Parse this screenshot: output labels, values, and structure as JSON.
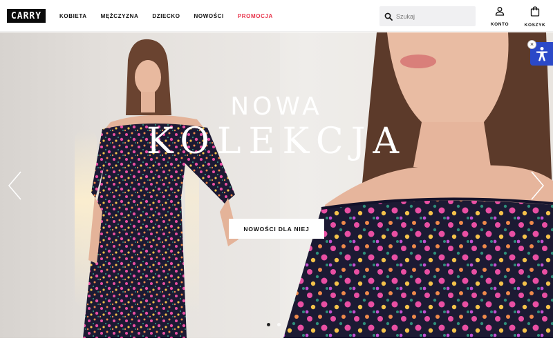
{
  "brand": {
    "logo_text": "CARRY"
  },
  "nav": {
    "items": [
      {
        "label": "KOBIETA"
      },
      {
        "label": "MĘŻCZYZNA"
      },
      {
        "label": "DZIECKO"
      },
      {
        "label": "NOWOŚCI"
      },
      {
        "label": "PROMOCJA"
      }
    ]
  },
  "search": {
    "placeholder": "Szukaj",
    "value": ""
  },
  "header_icons": {
    "account_label": "KONTO",
    "cart_label": "KOSZYK"
  },
  "hero": {
    "headline_line1": "NOWA",
    "headline_line2": "KOLEKCJA",
    "cta_label": "NOWOŚCI DLA NIEJ",
    "slide_count": 2,
    "active_slide": 1
  },
  "accessibility": {
    "close_glyph": "×"
  },
  "colors": {
    "promo": "#e8334a",
    "accessibility_button": "#2b49c8",
    "dress_base": "#1c1a33",
    "flower_pink": "#e94fa3",
    "flower_orange": "#f08a4b",
    "leaf_green": "#2f8f7a"
  }
}
